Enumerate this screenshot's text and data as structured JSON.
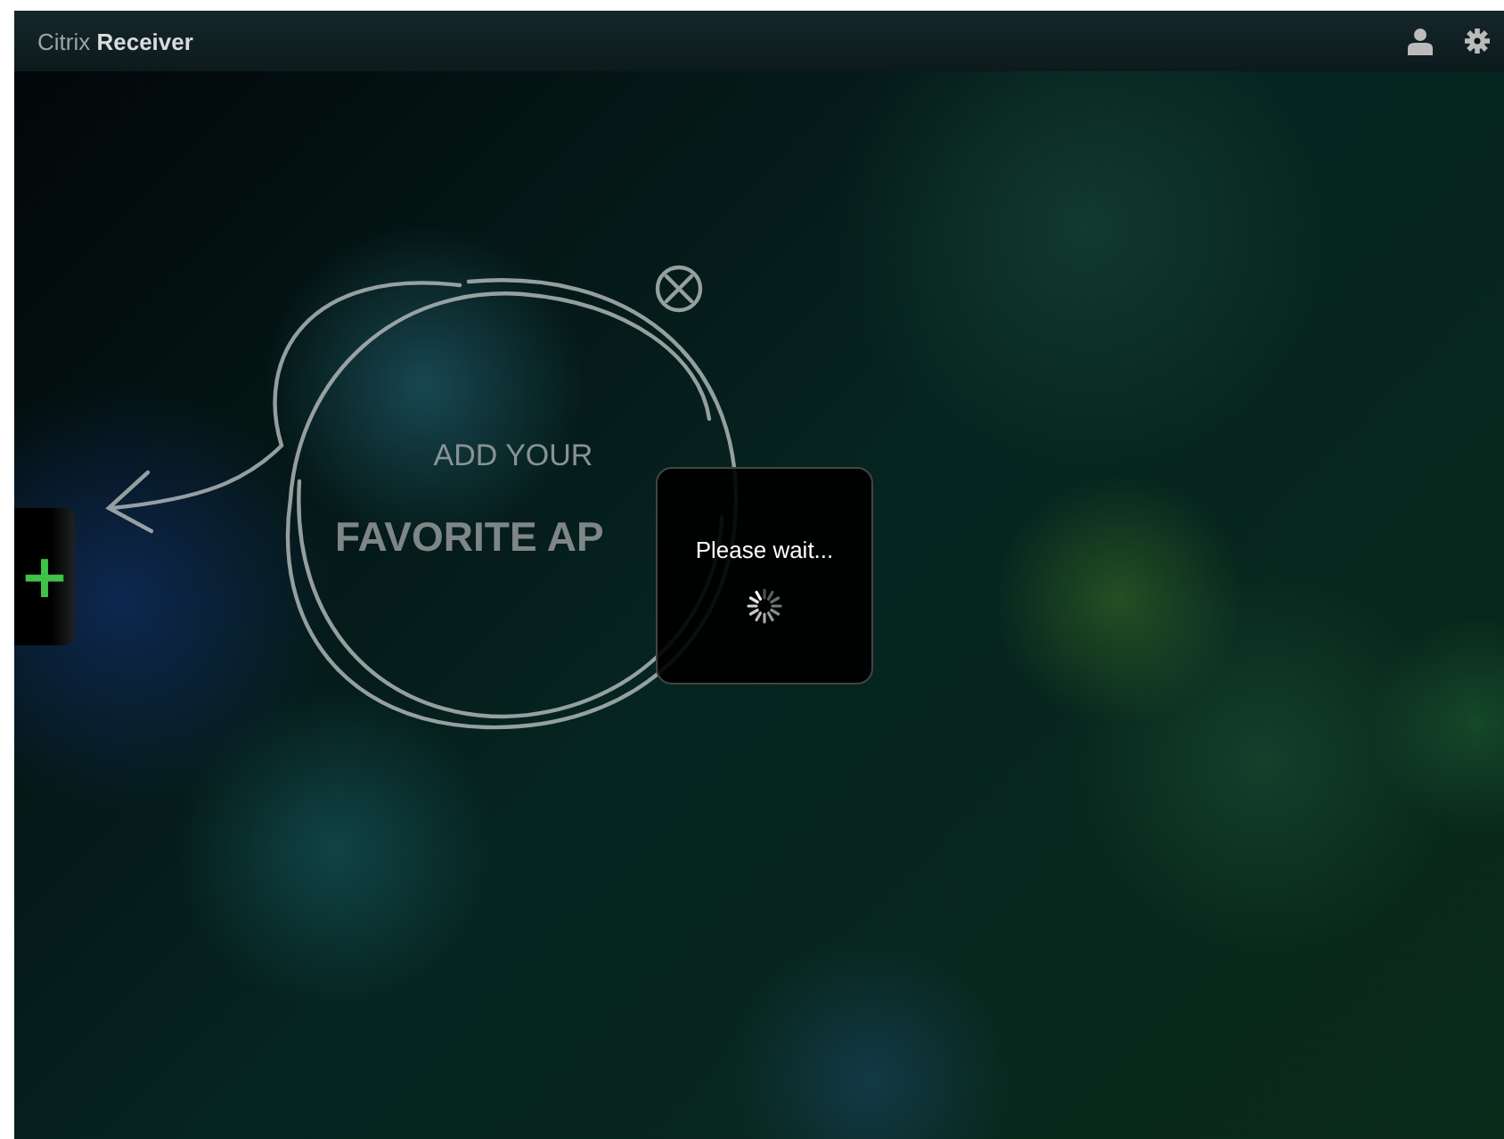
{
  "header": {
    "logo": "Citrix **Receiver**"
  },
  "hint": {
    "line_1": "ADD YOUR",
    "line_2": "FAVORITE AP"
  },
  "side_tab": {
    "label": "+"
  },
  "loading": {
    "message": "Please wait..."
  }
}
